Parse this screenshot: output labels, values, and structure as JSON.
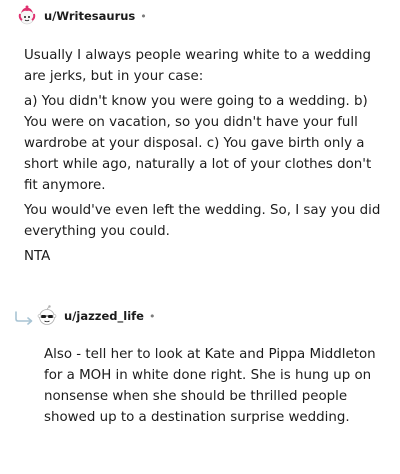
{
  "comments": [
    {
      "username": "u/Writesaurus",
      "separator": "•",
      "avatar": "snoo-avatar-pink-icon",
      "paragraphs": [
        "Usually I always people wearing white to a wedding are jerks, but in your case:",
        "a) You didn't know you were going to a wedding. b) You were on vacation, so you didn't have your full wardrobe at your disposal. c) You gave birth only a short while ago, naturally a lot of your clothes don't fit anymore.",
        "You would've even left the wedding. So, I say you did everything you could.",
        "NTA"
      ]
    },
    {
      "username": "u/jazzed_life",
      "separator": "•",
      "avatar": "snoo-avatar-sunglasses-icon",
      "reply_icon": "reply-arrow-icon",
      "paragraphs": [
        "Also - tell her to look at Kate and Pippa Middleton for a MOH in white done right. She is hung up on nonsense when she should be thrilled people showed up to a destination surprise wedding."
      ]
    }
  ],
  "colors": {
    "text": "#1c1c1c",
    "meta": "#7c7c7c",
    "reply_arrow": "#a8c4d4"
  }
}
